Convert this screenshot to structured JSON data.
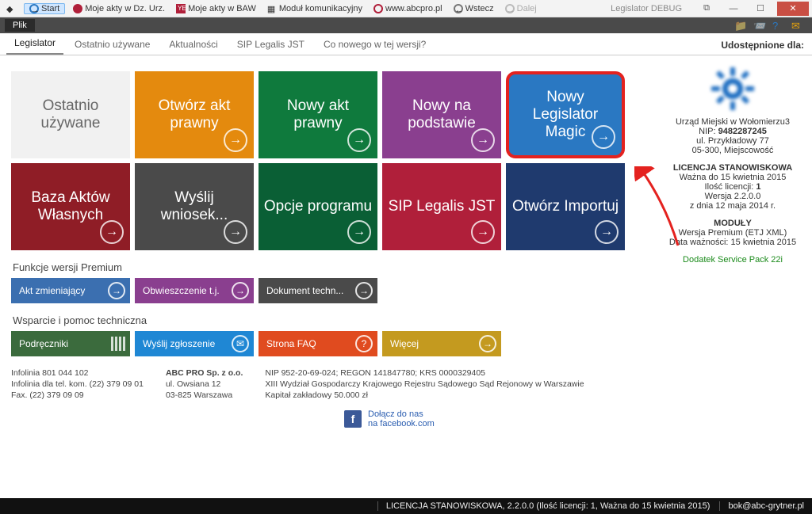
{
  "toolbar": {
    "start": "Start",
    "items": [
      "Moje akty w Dz. Urz.",
      "Moje akty w BAW",
      "Moduł komunikacyjny",
      "www.abcpro.pl",
      "Wstecz",
      "Dalej"
    ],
    "app_title": "Legislator  DEBUG"
  },
  "menu": {
    "file": "Plik"
  },
  "tabs": [
    {
      "label": "Legislator",
      "active": true
    },
    {
      "label": "Ostatnio używane",
      "active": false
    },
    {
      "label": "Aktualności",
      "active": false
    },
    {
      "label": "SIP Legalis JST",
      "active": false
    },
    {
      "label": "Co nowego w tej wersji?",
      "active": false
    }
  ],
  "shared_for_label": "Udostępnione dla:",
  "tiles": [
    {
      "label": "Ostatnio używane",
      "color": "gray"
    },
    {
      "label": "Otwórz akt prawny",
      "color": "orange"
    },
    {
      "label": "Nowy akt prawny",
      "color": "green"
    },
    {
      "label": "Nowy na podstawie",
      "color": "purple"
    },
    {
      "label": "Nowy Legislator Magic",
      "color": "blue",
      "highlight": true
    },
    {
      "label": "Baza Aktów Własnych",
      "color": "darkred"
    },
    {
      "label": "Wyślij wniosek...",
      "color": "dkgray"
    },
    {
      "label": "Opcje programu",
      "color": "dkgreen"
    },
    {
      "label": "SIP Legalis JST",
      "color": "crimson"
    },
    {
      "label": "Otwórz Importuj",
      "color": "navy"
    }
  ],
  "premium": {
    "heading": "Funkcje wersji Premium",
    "items": [
      {
        "label": "Akt zmieniający",
        "color": "blue2"
      },
      {
        "label": "Obwieszczenie t.j.",
        "color": "purple2"
      },
      {
        "label": "Dokument techn...",
        "color": "dgray2"
      }
    ]
  },
  "support": {
    "heading": "Wsparcie i pomoc techniczna",
    "items": [
      {
        "label": "Podręczniki",
        "color": "green2",
        "icon": "bars"
      },
      {
        "label": "Wyślij zgłoszenie",
        "color": "blue3",
        "icon": "mail"
      },
      {
        "label": "Strona FAQ",
        "color": "orange2",
        "icon": "help"
      },
      {
        "label": "Więcej",
        "color": "yellow2",
        "icon": "arrow"
      }
    ]
  },
  "company": {
    "col1": [
      "Infolinia 801 044 102",
      "Infolinia dla tel. kom. (22) 379 09 01",
      "Fax. (22) 379 09 09"
    ],
    "col2_title": "ABC PRO Sp. z o.o.",
    "col2": [
      "ul. Owsiana 12",
      "03-825 Warszawa"
    ],
    "col3": [
      "NIP 952-20-69-024; REGON 141847780; KRS 0000329405",
      "XIII Wydział Gospodarczy Krajowego Rejestru Sądowego Sąd Rejonowy w Warszawie",
      "Kapitał zakładowy 50.000 zł"
    ],
    "facebook_line1": "Dołącz do nas",
    "facebook_line2": "na facebook.com"
  },
  "side": {
    "org1": "Urząd Miejski w Wołomierzu3",
    "nip_lbl": "NIP:",
    "nip": "9482287245",
    "addr1": "ul. Przykładowy 77",
    "addr2": "05-300, Miejscowość",
    "lic_hdr": "LICENCJA STANOWISKOWA",
    "lic_wazna": "Ważna do 15 kwietnia 2015",
    "lic_ilosc_lbl": "Ilość licencji:",
    "lic_ilosc": "1",
    "lic_wersja": "Wersja 2.2.0.0",
    "lic_zdnia": "z dnia 12 maja 2014 r.",
    "mod_hdr": "MODUŁY",
    "mod1": "Wersja Premium (ETJ XML)",
    "mod2": "Data ważności: 15 kwietnia 2015",
    "sp": "Dodatek Service Pack 22i"
  },
  "status": {
    "lic": "LICENCJA STANOWISKOWA, 2.2.0.0 (Ilość licencji: 1, Ważna do 15 kwietnia 2015)",
    "email": "bok@abc-grytner.pl"
  }
}
